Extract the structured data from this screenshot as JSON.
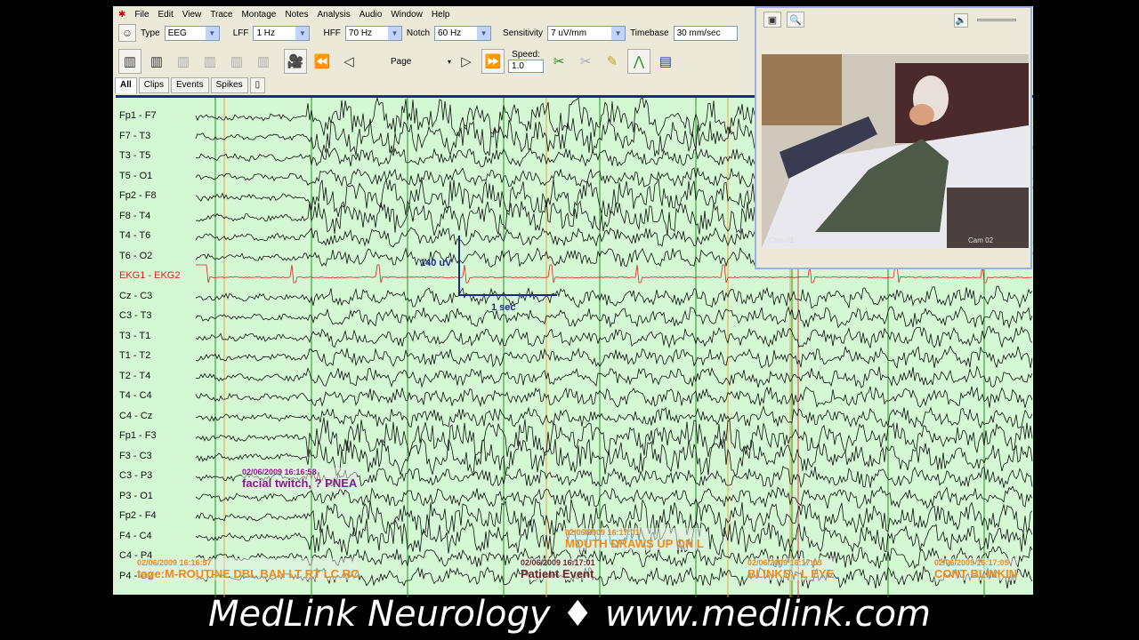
{
  "menu": [
    "File",
    "Edit",
    "View",
    "Trace",
    "Montage",
    "Notes",
    "Analysis",
    "Audio",
    "Window",
    "Help"
  ],
  "toolbar": {
    "type_label": "Type",
    "type_value": "EEG",
    "lff_label": "LFF",
    "lff_value": "1 Hz",
    "hff_label": "HFF",
    "hff_value": "70 Hz",
    "notch_label": "Notch",
    "notch_value": "60 Hz",
    "sensitivity_label": "Sensitivity",
    "sensitivity_value": "7 uV/mm",
    "timebase_label": "Timebase",
    "timebase_value": "30 mm/sec",
    "page_label": "Page",
    "speed_label": "Speed:",
    "speed_value": "1.0"
  },
  "tabs": [
    "All",
    "Clips",
    "Events",
    "Spikes"
  ],
  "channels": [
    "Fp1 - F7",
    "F7 - T3",
    "T3 - T5",
    "T5 - O1",
    "Fp2 - F8",
    "F8 - T4",
    "T4 - T6",
    "T6 - O2",
    "EKG1 - EKG2",
    "Cz - C3",
    "C3 - T3",
    "T3 - T1",
    "T1 - T2",
    "T2 - T4",
    "T4 - C4",
    "C4 - Cz",
    "Fp1 - F3",
    "F3 - C3",
    "C3 - P3",
    "P3 - O1",
    "Fp2 - F4",
    "F4 - C4",
    "C4 - P4",
    "P4 - O2"
  ],
  "calibration": {
    "amplitude": "140 uV",
    "time": "1 sec"
  },
  "annotations": [
    {
      "timestamp": "02/06/2009 16:16:58",
      "text": "facial twitch, ? PNEA",
      "color": "#8a1a8a"
    },
    {
      "timestamp": "02/06/2009 16:17:01",
      "text": "MOUTH DRAWS UP ON L",
      "color": "#f08a1a"
    },
    {
      "timestamp": "02/06/2009 16:16:57",
      "text": "tage:M-ROUTINE DBL BAN LT RT LC RC",
      "color": "#f08a1a"
    },
    {
      "timestamp": "02/06/2009 16:17:01",
      "text": "Patient Event",
      "color": "#6a2a2a"
    },
    {
      "timestamp": "02/06/2009 16:17:03",
      "text": "BLINKS - L EYE",
      "color": "#f08a1a"
    },
    {
      "timestamp": "02/06/2009 16:17:05",
      "text": "CONT BLINKIN",
      "color": "#f08a1a"
    }
  ],
  "video": {
    "cam1": "Cam 01",
    "cam2": "Cam 02"
  },
  "footer": "MedLink Neurology ♦ www.medlink.com",
  "colors": {
    "trace": "#111111",
    "ekg": "#e02020",
    "background": "#d4f7d4",
    "second_marker": "#1a9a1a",
    "event_marker": "#f0a040"
  }
}
